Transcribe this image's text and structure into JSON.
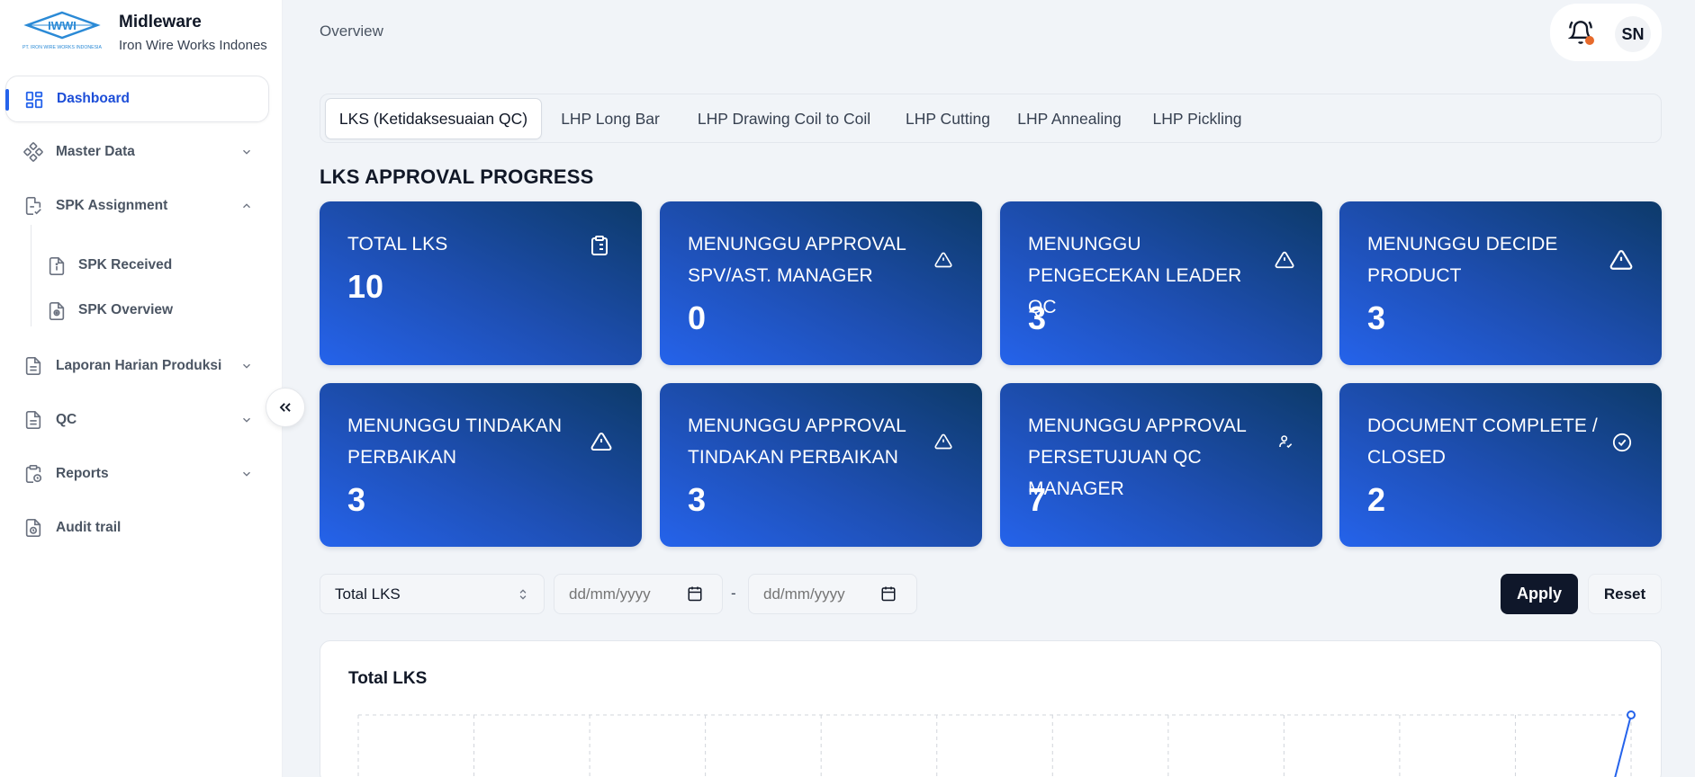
{
  "app": {
    "name": "Midleware",
    "company": "Iron Wire Works Indones",
    "logo_text": "IWWI",
    "logo_subtext": "PT. IRON WIRE WORKS INDONESIA"
  },
  "sidebar": {
    "items": [
      {
        "label": "Dashboard",
        "icon": "dashboard-icon",
        "active": true
      },
      {
        "label": "Master Data",
        "icon": "master-data-icon",
        "expanded": false
      },
      {
        "label": "SPK Assignment",
        "icon": "spk-assignment-icon",
        "expanded": true
      },
      {
        "label": "Laporan Harian Produksi",
        "icon": "document-icon",
        "expanded": false
      },
      {
        "label": "QC",
        "icon": "document-icon",
        "expanded": false
      },
      {
        "label": "Reports",
        "icon": "clipboard-clock-icon",
        "expanded": false
      },
      {
        "label": "Audit trail",
        "icon": "file-clock-icon"
      }
    ],
    "sub_items": [
      {
        "label": "SPK Received",
        "icon": "file-info-icon"
      },
      {
        "label": "SPK Overview",
        "icon": "file-search-icon"
      }
    ]
  },
  "header": {
    "title": "Overview",
    "avatar_initials": "SN"
  },
  "tabs": [
    {
      "label": "LKS (Ketidaksesuaian QC)",
      "active": true
    },
    {
      "label": "LHP Long Bar"
    },
    {
      "label": "LHP Drawing Coil to Coil"
    },
    {
      "label": "LHP Cutting"
    },
    {
      "label": "LHP Annealing"
    },
    {
      "label": "LHP Pickling"
    }
  ],
  "section_title": "LKS APPROVAL PROGRESS",
  "cards": [
    {
      "label": "TOTAL LKS",
      "value": "10",
      "icon": "clipboard-list-icon"
    },
    {
      "label": "MENUNGGU APPROVAL SPV/AST. MANAGER",
      "value": "0",
      "icon": "warning-icon"
    },
    {
      "label": "MENUNGGU PENGECEKAN LEADER QC",
      "value": "3",
      "icon": "warning-icon"
    },
    {
      "label": "MENUNGGU DECIDE PRODUCT",
      "value": "3",
      "icon": "warning-icon"
    },
    {
      "label": "MENUNGGU TINDAKAN PERBAIKAN",
      "value": "3",
      "icon": "warning-icon"
    },
    {
      "label": "MENUNGGU APPROVAL TINDAKAN PERBAIKAN",
      "value": "3",
      "icon": "warning-icon"
    },
    {
      "label": "MENUNGGU APPROVAL PERSETUJUAN QC MANAGER",
      "value": "7",
      "icon": "user-check-icon"
    },
    {
      "label": "DOCUMENT COMPLETE / CLOSED",
      "value": "2",
      "icon": "check-circle-icon"
    }
  ],
  "filters": {
    "select_value": "Total LKS",
    "date_from_placeholder": "dd/mm/yyyy",
    "date_to_placeholder": "dd/mm/yyyy",
    "separator": "-",
    "apply_label": "Apply",
    "reset_label": "Reset"
  },
  "chart": {
    "title": "Total LKS"
  },
  "colors": {
    "accent": "#2563eb",
    "card_dark": "#0d3a6a",
    "apply_button": "#0f172a",
    "notification_dot": "#e76a2b"
  }
}
